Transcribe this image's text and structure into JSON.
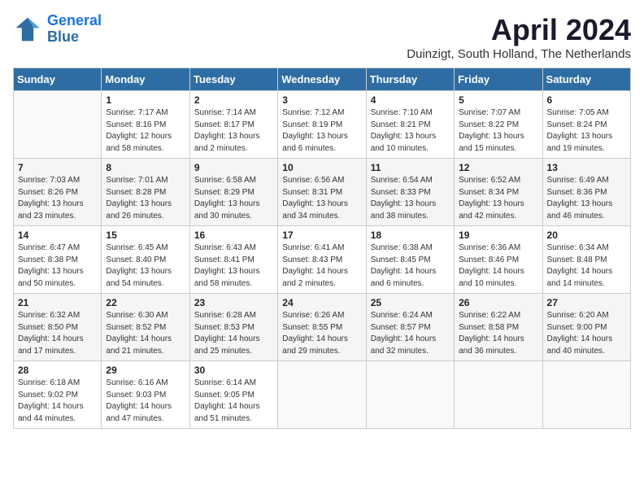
{
  "header": {
    "logo_line1": "General",
    "logo_line2": "Blue",
    "month_year": "April 2024",
    "location": "Duinzigt, South Holland, The Netherlands"
  },
  "columns": [
    "Sunday",
    "Monday",
    "Tuesday",
    "Wednesday",
    "Thursday",
    "Friday",
    "Saturday"
  ],
  "weeks": [
    [
      {
        "day": "",
        "info": ""
      },
      {
        "day": "1",
        "info": "Sunrise: 7:17 AM\nSunset: 8:16 PM\nDaylight: 12 hours\nand 58 minutes."
      },
      {
        "day": "2",
        "info": "Sunrise: 7:14 AM\nSunset: 8:17 PM\nDaylight: 13 hours\nand 2 minutes."
      },
      {
        "day": "3",
        "info": "Sunrise: 7:12 AM\nSunset: 8:19 PM\nDaylight: 13 hours\nand 6 minutes."
      },
      {
        "day": "4",
        "info": "Sunrise: 7:10 AM\nSunset: 8:21 PM\nDaylight: 13 hours\nand 10 minutes."
      },
      {
        "day": "5",
        "info": "Sunrise: 7:07 AM\nSunset: 8:22 PM\nDaylight: 13 hours\nand 15 minutes."
      },
      {
        "day": "6",
        "info": "Sunrise: 7:05 AM\nSunset: 8:24 PM\nDaylight: 13 hours\nand 19 minutes."
      }
    ],
    [
      {
        "day": "7",
        "info": "Sunrise: 7:03 AM\nSunset: 8:26 PM\nDaylight: 13 hours\nand 23 minutes."
      },
      {
        "day": "8",
        "info": "Sunrise: 7:01 AM\nSunset: 8:28 PM\nDaylight: 13 hours\nand 26 minutes."
      },
      {
        "day": "9",
        "info": "Sunrise: 6:58 AM\nSunset: 8:29 PM\nDaylight: 13 hours\nand 30 minutes."
      },
      {
        "day": "10",
        "info": "Sunrise: 6:56 AM\nSunset: 8:31 PM\nDaylight: 13 hours\nand 34 minutes."
      },
      {
        "day": "11",
        "info": "Sunrise: 6:54 AM\nSunset: 8:33 PM\nDaylight: 13 hours\nand 38 minutes."
      },
      {
        "day": "12",
        "info": "Sunrise: 6:52 AM\nSunset: 8:34 PM\nDaylight: 13 hours\nand 42 minutes."
      },
      {
        "day": "13",
        "info": "Sunrise: 6:49 AM\nSunset: 8:36 PM\nDaylight: 13 hours\nand 46 minutes."
      }
    ],
    [
      {
        "day": "14",
        "info": "Sunrise: 6:47 AM\nSunset: 8:38 PM\nDaylight: 13 hours\nand 50 minutes."
      },
      {
        "day": "15",
        "info": "Sunrise: 6:45 AM\nSunset: 8:40 PM\nDaylight: 13 hours\nand 54 minutes."
      },
      {
        "day": "16",
        "info": "Sunrise: 6:43 AM\nSunset: 8:41 PM\nDaylight: 13 hours\nand 58 minutes."
      },
      {
        "day": "17",
        "info": "Sunrise: 6:41 AM\nSunset: 8:43 PM\nDaylight: 14 hours\nand 2 minutes."
      },
      {
        "day": "18",
        "info": "Sunrise: 6:38 AM\nSunset: 8:45 PM\nDaylight: 14 hours\nand 6 minutes."
      },
      {
        "day": "19",
        "info": "Sunrise: 6:36 AM\nSunset: 8:46 PM\nDaylight: 14 hours\nand 10 minutes."
      },
      {
        "day": "20",
        "info": "Sunrise: 6:34 AM\nSunset: 8:48 PM\nDaylight: 14 hours\nand 14 minutes."
      }
    ],
    [
      {
        "day": "21",
        "info": "Sunrise: 6:32 AM\nSunset: 8:50 PM\nDaylight: 14 hours\nand 17 minutes."
      },
      {
        "day": "22",
        "info": "Sunrise: 6:30 AM\nSunset: 8:52 PM\nDaylight: 14 hours\nand 21 minutes."
      },
      {
        "day": "23",
        "info": "Sunrise: 6:28 AM\nSunset: 8:53 PM\nDaylight: 14 hours\nand 25 minutes."
      },
      {
        "day": "24",
        "info": "Sunrise: 6:26 AM\nSunset: 8:55 PM\nDaylight: 14 hours\nand 29 minutes."
      },
      {
        "day": "25",
        "info": "Sunrise: 6:24 AM\nSunset: 8:57 PM\nDaylight: 14 hours\nand 32 minutes."
      },
      {
        "day": "26",
        "info": "Sunrise: 6:22 AM\nSunset: 8:58 PM\nDaylight: 14 hours\nand 36 minutes."
      },
      {
        "day": "27",
        "info": "Sunrise: 6:20 AM\nSunset: 9:00 PM\nDaylight: 14 hours\nand 40 minutes."
      }
    ],
    [
      {
        "day": "28",
        "info": "Sunrise: 6:18 AM\nSunset: 9:02 PM\nDaylight: 14 hours\nand 44 minutes."
      },
      {
        "day": "29",
        "info": "Sunrise: 6:16 AM\nSunset: 9:03 PM\nDaylight: 14 hours\nand 47 minutes."
      },
      {
        "day": "30",
        "info": "Sunrise: 6:14 AM\nSunset: 9:05 PM\nDaylight: 14 hours\nand 51 minutes."
      },
      {
        "day": "",
        "info": ""
      },
      {
        "day": "",
        "info": ""
      },
      {
        "day": "",
        "info": ""
      },
      {
        "day": "",
        "info": ""
      }
    ]
  ]
}
